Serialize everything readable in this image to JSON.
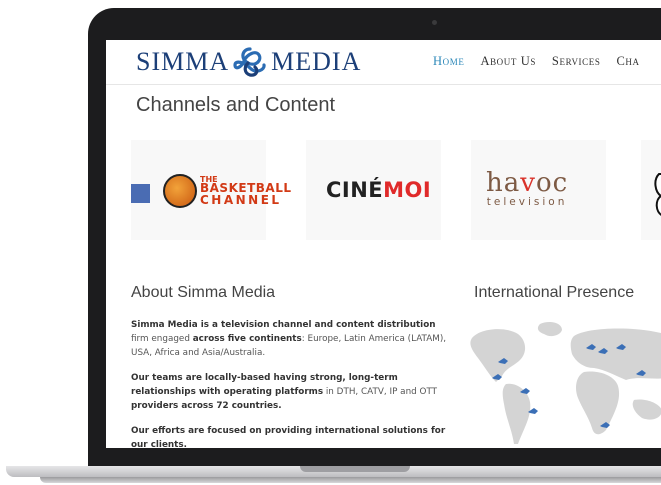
{
  "brand": {
    "name_left": "SIMMA",
    "name_right": "MEDIA"
  },
  "nav": {
    "items": [
      "Home",
      "About Us",
      "Services",
      "Cha"
    ],
    "active_index": 0
  },
  "channels": {
    "title": "Channels and Content",
    "logos": [
      {
        "line1": "THE",
        "line2": "BASKETBALL",
        "line3": "CHANNEL"
      },
      {
        "part1": "CINÉ",
        "part2": "MOI"
      },
      {
        "part1": "ha",
        "part2": "v",
        "part3": "oc",
        "sub": "television"
      },
      {
        "partial": "BI"
      }
    ]
  },
  "about": {
    "title": "About Simma Media",
    "p1_b1": "Simma Media is a television channel and content distribution",
    "p1_t1": " firm engaged ",
    "p1_b2": "across five continents",
    "p1_t2": ": Europe, Latin America (LATAM), USA, Africa and Asia/Australia.",
    "p2_b1": "Our teams are locally-based having strong, long-term relationships with operating platforms",
    "p2_t1": " in DTH, CATV, IP and OTT ",
    "p2_b2": "providers across 72 countries.",
    "p3_b1": "Our efforts are focused on providing international solutions for our clients."
  },
  "international": {
    "title": "International Presence"
  },
  "colors": {
    "brand_blue": "#1c3f78",
    "nav_active": "#2b87b8",
    "accent_square": "#4a6cb3",
    "marker": "#3b6fb6"
  }
}
